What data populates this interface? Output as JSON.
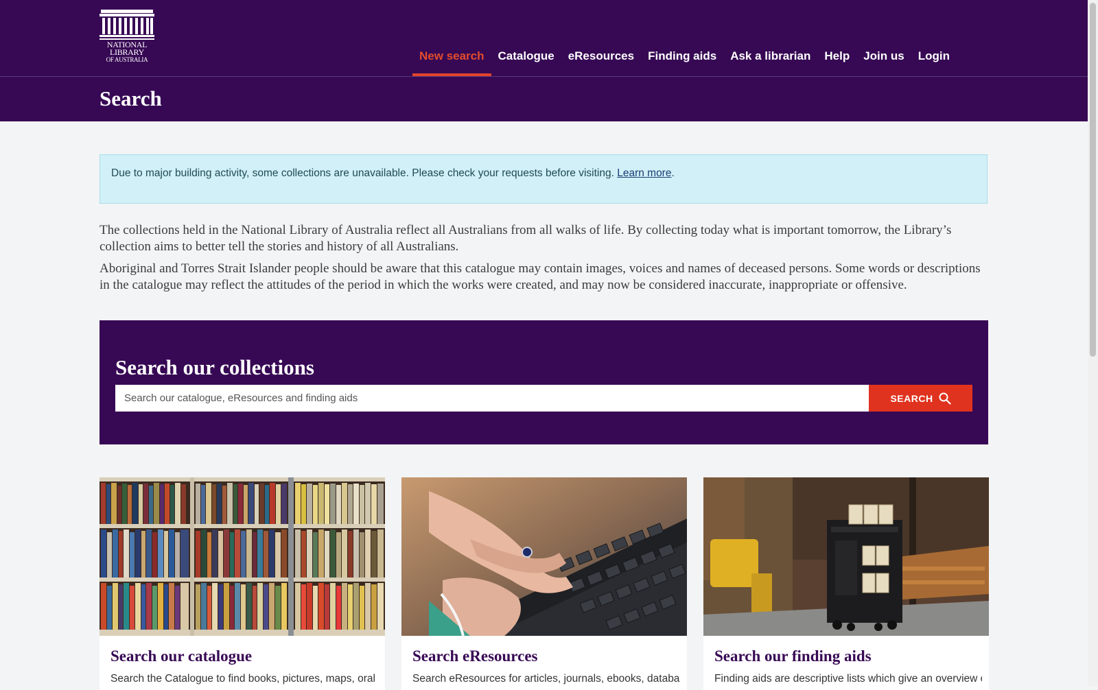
{
  "header": {
    "logo": {
      "line1": "NATIONAL",
      "line2": "LIBRARY",
      "line3": "OF AUSTRALIA"
    },
    "nav": [
      {
        "label": "New search",
        "active": true
      },
      {
        "label": "Catalogue",
        "active": false
      },
      {
        "label": "eResources",
        "active": false
      },
      {
        "label": "Finding aids",
        "active": false
      },
      {
        "label": "Ask a librarian",
        "active": false
      },
      {
        "label": "Help",
        "active": false
      },
      {
        "label": "Join us",
        "active": false
      },
      {
        "label": "Login",
        "active": false
      }
    ],
    "page_title": "Search"
  },
  "alert": {
    "text": "Due to major building activity, some collections are unavailable. Please check your requests before visiting. ",
    "link": "Learn more",
    "suffix": "."
  },
  "intro": {
    "p1": "The collections held in the National Library of Australia reflect all Australians from all walks of life. By collecting today what is important tomorrow, the Library’s collection aims to better tell the stories and history of all Australians.",
    "p2": "Aboriginal and Torres Strait Islander people should be aware that this catalogue may contain images, voices and names of deceased persons. Some words or descriptions in the catalogue may reflect the attitudes of the period in which the works were created, and may now be considered inaccurate, inappropriate or offensive."
  },
  "search": {
    "heading": "Search our collections",
    "placeholder": "Search our catalogue, eResources and finding aids",
    "button": "SEARCH",
    "button_icon": "search-icon"
  },
  "cards": [
    {
      "title": "Search our catalogue",
      "desc": "Search the Catalogue to find books, pictures, maps, oral",
      "image": "bookshelf-photo"
    },
    {
      "title": "Search eResources",
      "desc": "Search eResources for articles, journals, ebooks, databases",
      "image": "keyboard-photo"
    },
    {
      "title": "Search our finding aids",
      "desc": "Finding aids are descriptive lists which give an overview of",
      "image": "reading-room-trolley-photo"
    }
  ],
  "colors": {
    "brand_purple": "#370954",
    "accent_red": "#e0331f",
    "alert_bg": "#d1f0f8"
  }
}
